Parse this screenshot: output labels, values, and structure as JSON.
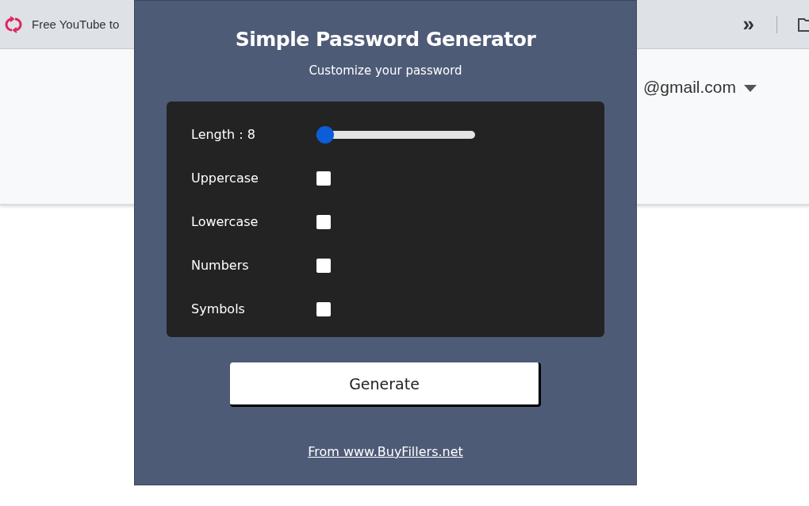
{
  "bookmarks_bar": {
    "bookmark": "Free YouTube to",
    "overflow": "»"
  },
  "account": {
    "email": "@gmail.com"
  },
  "popup": {
    "title": "Simple Password Generator",
    "subtitle": "Customize your password",
    "options": [
      {
        "kind": "slider",
        "label": "Length : 8",
        "level": 0
      },
      {
        "kind": "checkbox",
        "label": "Uppercase",
        "checked": false
      },
      {
        "kind": "checkbox",
        "label": "Lowercase",
        "checked": false
      },
      {
        "kind": "checkbox",
        "label": "Numbers",
        "checked": false
      },
      {
        "kind": "checkbox",
        "label": "Symbols",
        "checked": false
      }
    ],
    "button": "Generate",
    "footer_link": "From www.BuyFillers.net"
  }
}
